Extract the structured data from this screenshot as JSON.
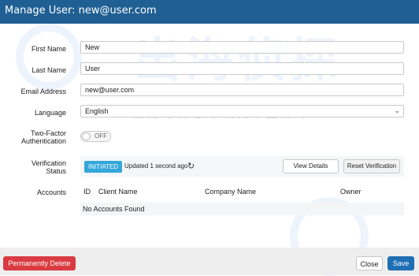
{
  "header": {
    "title": "Manage User: new@user.com"
  },
  "form": {
    "first_name": {
      "label": "First Name",
      "value": "New"
    },
    "last_name": {
      "label": "Last Name",
      "value": "User"
    },
    "email": {
      "label": "Email Address",
      "value": "new@user.com"
    },
    "language": {
      "label": "Language",
      "value": "English"
    },
    "two_factor": {
      "label_line1": "Two-Factor",
      "label_line2": "Authentication",
      "toggle_text": "OFF",
      "enabled": false
    }
  },
  "verification": {
    "label_line1": "Verification",
    "label_line2": "Status",
    "status_badge": "INITIATED",
    "updated_text": "Updated 1 second ago",
    "view_details_label": "View Details",
    "reset_label": "Reset Verification"
  },
  "accounts": {
    "label": "Accounts",
    "columns": [
      "ID",
      "Client Name",
      "Company Name",
      "Owner"
    ],
    "empty_text": "No Accounts Found"
  },
  "footer": {
    "delete_label": "Permanently Delete",
    "close_label": "Close",
    "save_label": "Save"
  },
  "watermark": {
    "text": "出海侦探",
    "slogan": "服务跨境电商 助力中企出海"
  },
  "colors": {
    "header_bg": "#1f5f93",
    "badge_bg": "#34a7d9",
    "danger": "#d93b41",
    "primary": "#1f6fb4"
  }
}
